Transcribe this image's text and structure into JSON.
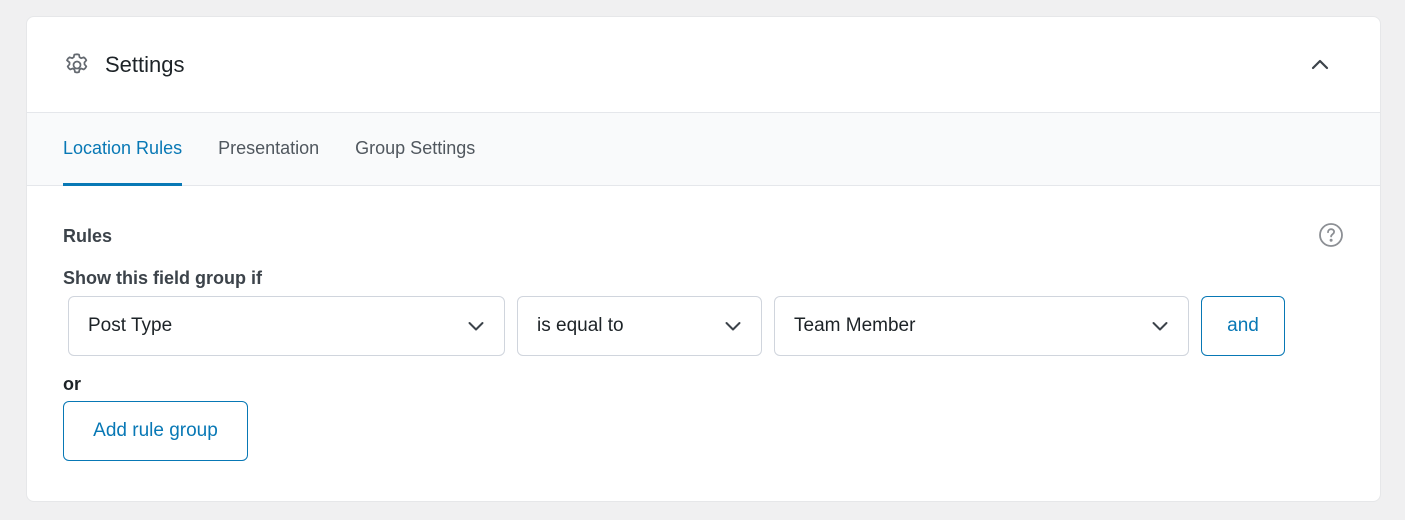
{
  "header": {
    "title": "Settings",
    "icon": "gear-icon",
    "collapse_icon": "chevron-up-icon"
  },
  "tabs": [
    {
      "label": "Location Rules",
      "active": true
    },
    {
      "label": "Presentation",
      "active": false
    },
    {
      "label": "Group Settings",
      "active": false
    }
  ],
  "rules": {
    "label": "Rules",
    "help_icon": "question-circle-icon",
    "show_if": "Show this field group if",
    "rule": {
      "param": "Post Type",
      "operator": "is equal to",
      "value": "Team Member"
    },
    "and_label": "and",
    "or_label": "or",
    "add_group_label": "Add rule group"
  },
  "colors": {
    "accent": "#0878b5",
    "text": "#1d2327",
    "muted": "#50575e",
    "border": "#d0d5dd",
    "page_bg": "#f0f0f1"
  }
}
